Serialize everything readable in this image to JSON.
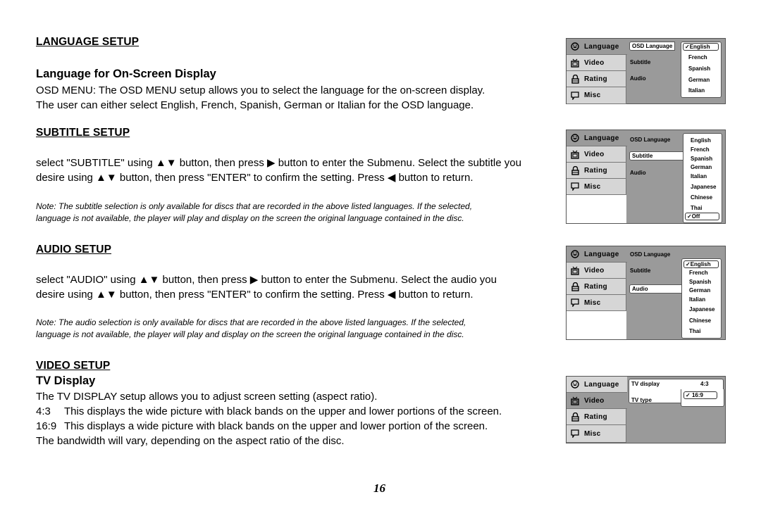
{
  "language_setup": {
    "heading": "LANGUAGE SETUP",
    "subheading": "Language for On-Screen Display",
    "lines": [
      "OSD MENU: The OSD MENU setup allows you to select the language for the on-screen display.",
      "The user can either select English, French, Spanish, German or Italian for the OSD language."
    ]
  },
  "subtitle_setup": {
    "heading": "SUBTITLE SETUP",
    "lines": [
      "select \"SUBTITLE\" using ▲▼ button, then press ▶ button to enter the Submenu. Select the subtitle you",
      "desire using ▲▼ button, then press \"ENTER\" to confirm the setting. Press ◀ button to return."
    ],
    "note": [
      "Note: The subtitle selection is only available for discs that are recorded in the above listed languages. If the selected,",
      "language is not available, the player will play and display on the screen the original language contained in the disc."
    ]
  },
  "audio_setup": {
    "heading": "AUDIO SETUP",
    "lines": [
      "select \"AUDIO\" using ▲▼ button, then press ▶ button to enter the Submenu. Select the audio you",
      "desire using ▲▼ button, then press \"ENTER\" to confirm the setting. Press ◀ button to return."
    ],
    "note": [
      "Note: The audio selection is only available for discs that are recorded in the above listed languages. If the selected,",
      "language is not available, the player will play and display on the screen the original language contained in the disc."
    ]
  },
  "video_setup": {
    "heading": "VIDEO SETUP",
    "subheading": "TV Display",
    "intro": "The TV DISPLAY setup allows you to adjust screen setting (aspect ratio).",
    "items": [
      {
        "key": "4:3",
        "text": "This displays the wide picture with black bands on the upper and lower portions of the screen."
      },
      {
        "key": "16:9",
        "text": "This displays a wide picture with black bands on the upper and lower portion of the screen."
      }
    ],
    "outro": "The bandwidth will vary, depending on the aspect ratio of the disc."
  },
  "page_number": "16",
  "osd_menu": {
    "sidebar": [
      {
        "label": "Language",
        "icon": "smiley-icon"
      },
      {
        "label": "Video",
        "icon": "tv-icon"
      },
      {
        "label": "Rating",
        "icon": "lock-icon"
      },
      {
        "label": "Misc",
        "icon": "speech-bubble-icon"
      }
    ],
    "language_items": [
      "OSD Language",
      "Subtitle",
      "Audio"
    ],
    "video_items": [
      "TV display",
      "TV type"
    ],
    "panels": {
      "osd_language": {
        "selected_item": "OSD Language",
        "options": [
          "English",
          "French",
          "Spanish",
          "German",
          "Italian"
        ],
        "checked": "English",
        "check_mark": "✓"
      },
      "subtitle": {
        "selected_item": "Subtitle",
        "options": [
          "English",
          "French",
          "Spanish",
          "German",
          "Italian",
          "Japanese",
          "Chinese",
          "Thai",
          "Off"
        ],
        "checked": "Off",
        "check_mark": "✓"
      },
      "audio": {
        "selected_item": "Audio",
        "options": [
          "English",
          "French",
          "Spanish",
          "German",
          "Italian",
          "Japanese",
          "Chinese",
          "Thai"
        ],
        "checked": "English",
        "check_mark": "✓"
      },
      "tv_display": {
        "selected_item": "TV display",
        "options": [
          "4:3",
          "16:9"
        ],
        "checked": "16:9",
        "check_mark": "✓"
      }
    },
    "colors": {
      "panel_bg": "#9a9a9a",
      "tab_bg": "#d6d6d6",
      "highlight": "#ffffff",
      "border": "#555555"
    }
  }
}
